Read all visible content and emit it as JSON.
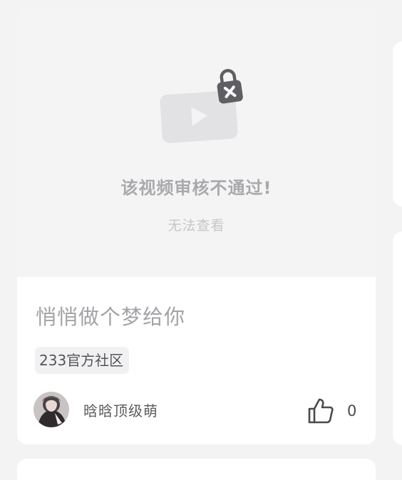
{
  "card": {
    "media": {
      "status_title": "该视频审核不通过!",
      "status_subtitle": "无法查看",
      "icon": "locked-video-icon"
    },
    "post_title": "悄悄做个梦给你",
    "tag": "233官方社区",
    "author": {
      "name": "晗晗顶级萌",
      "avatar_icon": "avatar"
    },
    "likes": {
      "icon": "thumbs-up-icon",
      "count": "0"
    }
  },
  "colors": {
    "page_background": "#f3f3f4",
    "card_background": "#ffffff",
    "media_background": "#f4f4f5",
    "video_placeholder": "#e2e2e4",
    "lock_body": "#5f5f63",
    "title_text": "#a3a3a7",
    "author_text": "#5b5b5f"
  }
}
